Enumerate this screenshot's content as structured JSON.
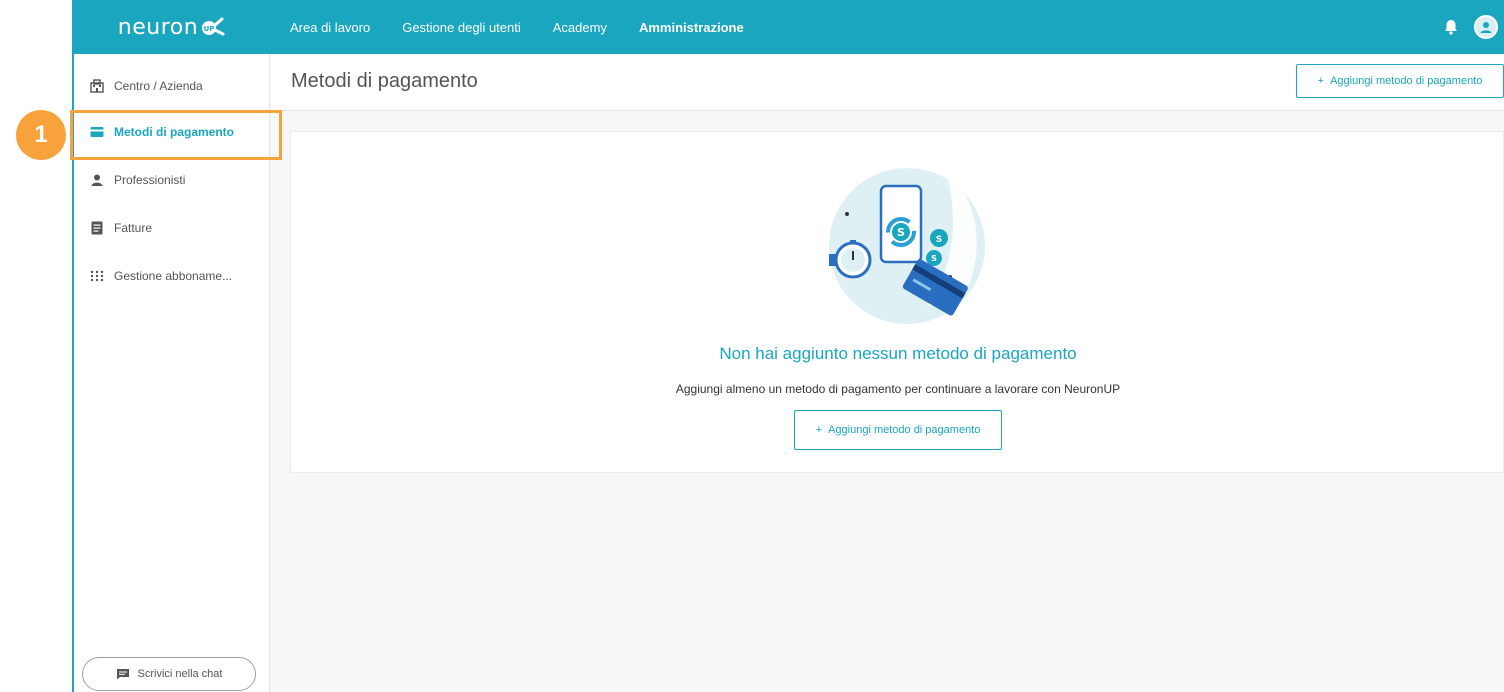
{
  "brand": {
    "logo_text": "neuron",
    "logo_badge": "UP"
  },
  "topnav": {
    "items": [
      {
        "label": "Area di lavoro",
        "active": false
      },
      {
        "label": "Gestione degli utenti",
        "active": false
      },
      {
        "label": "Academy",
        "active": false
      },
      {
        "label": "Amministrazione",
        "active": true
      }
    ]
  },
  "sidebar": {
    "items": [
      {
        "label": "Centro / Azienda",
        "icon": "building-icon",
        "active": false
      },
      {
        "label": "Metodi di pagamento",
        "icon": "credit-card-icon",
        "active": true
      },
      {
        "label": "Professionisti",
        "icon": "user-icon",
        "active": false
      },
      {
        "label": "Fatture",
        "icon": "invoice-icon",
        "active": false
      },
      {
        "label": "Gestione abboname...",
        "icon": "grid-dots-icon",
        "active": false
      }
    ],
    "chat_label": "Scrivici nella chat"
  },
  "header": {
    "title": "Metodi di pagamento",
    "add_button": "Aggiungi metodo di pagamento"
  },
  "empty_state": {
    "title": "Non hai aggiunto nessun metodo di pagamento",
    "subtitle": "Aggiungi almeno un metodo di pagamento per continuare a lavorare con NeuronUP",
    "button": "Aggiungi metodo di pagamento"
  },
  "callout": {
    "number": "1"
  },
  "colors": {
    "primary": "#1aa6bf",
    "callout": "#f7a23b",
    "background": "#f6f7f8"
  }
}
